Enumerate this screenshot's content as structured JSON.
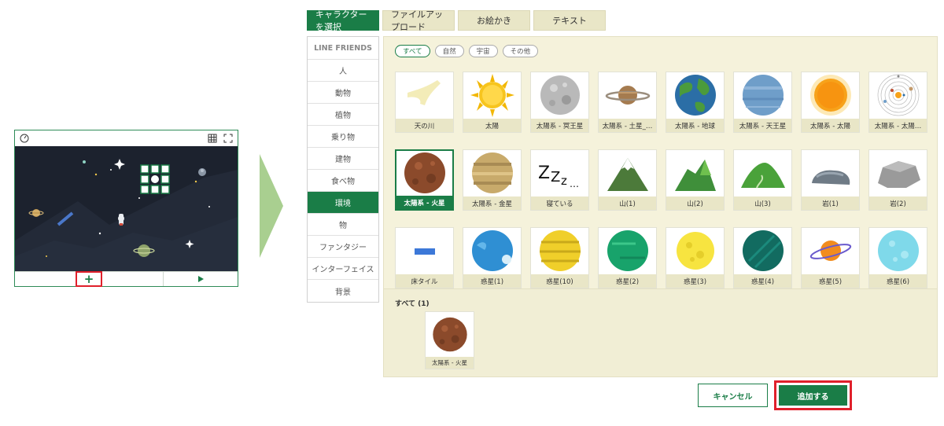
{
  "stage": {
    "add_label": "+",
    "play_label": "▶"
  },
  "tabs": [
    {
      "label": "キャラクターを選択",
      "active": true
    },
    {
      "label": "ファイルアップロード",
      "active": false
    },
    {
      "label": "お絵かき",
      "active": false
    },
    {
      "label": "テキスト",
      "active": false
    }
  ],
  "sidebar": {
    "items": [
      {
        "label": "LINE FRIENDS",
        "active": false
      },
      {
        "label": "人",
        "active": false
      },
      {
        "label": "動物",
        "active": false
      },
      {
        "label": "植物",
        "active": false
      },
      {
        "label": "乗り物",
        "active": false
      },
      {
        "label": "建物",
        "active": false
      },
      {
        "label": "食べ物",
        "active": false
      },
      {
        "label": "環境",
        "active": true
      },
      {
        "label": "物",
        "active": false
      },
      {
        "label": "ファンタジー",
        "active": false
      },
      {
        "label": "インターフェイス",
        "active": false
      },
      {
        "label": "背景",
        "active": false
      }
    ]
  },
  "filters": [
    {
      "label": "すべて",
      "active": true
    },
    {
      "label": "自然",
      "active": false
    },
    {
      "label": "宇宙",
      "active": false
    },
    {
      "label": "その他",
      "active": false
    }
  ],
  "characters": [
    {
      "label": "天の川",
      "icon": "milky-way-icon"
    },
    {
      "label": "太陽",
      "icon": "sun-icon"
    },
    {
      "label": "太陽系 - 冥王星",
      "icon": "pluto-icon"
    },
    {
      "label": "太陽系 - 土星_…",
      "icon": "saturn-icon"
    },
    {
      "label": "太陽系 - 地球",
      "icon": "earth-icon"
    },
    {
      "label": "太陽系 - 天王星",
      "icon": "uranus-icon"
    },
    {
      "label": "太陽系 - 太陽",
      "icon": "solar-sun-icon"
    },
    {
      "label": "太陽系 - 太陽…",
      "icon": "solar-system-icon"
    },
    {
      "label": "太陽系 - 火星",
      "icon": "mars-icon",
      "selected": true
    },
    {
      "label": "太陽系 - 金星",
      "icon": "venus-icon"
    },
    {
      "label": "寝ている",
      "icon": "sleeping-zzz-icon"
    },
    {
      "label": "山(1)",
      "icon": "mountain-1-icon"
    },
    {
      "label": "山(2)",
      "icon": "mountain-2-icon"
    },
    {
      "label": "山(3)",
      "icon": "mountain-3-icon"
    },
    {
      "label": "岩(1)",
      "icon": "rock-1-icon"
    },
    {
      "label": "岩(2)",
      "icon": "rock-2-icon"
    },
    {
      "label": "床タイル",
      "icon": "floor-tile-icon"
    },
    {
      "label": "惑星(1)",
      "icon": "planet-1-icon"
    },
    {
      "label": "惑星(10)",
      "icon": "planet-10-icon"
    },
    {
      "label": "惑星(2)",
      "icon": "planet-2-icon"
    },
    {
      "label": "惑星(3)",
      "icon": "planet-3-icon"
    },
    {
      "label": "惑星(4)",
      "icon": "planet-4-icon"
    },
    {
      "label": "惑星(5)",
      "icon": "planet-5-icon"
    },
    {
      "label": "惑星(6)",
      "icon": "planet-6-icon"
    }
  ],
  "selection": {
    "title": "すべて (1)",
    "items": [
      {
        "label": "太陽系 - 火星",
        "icon": "mars-icon"
      }
    ]
  },
  "buttons": {
    "cancel": "キャンセル",
    "add": "追加する"
  },
  "colors": {
    "accent": "#1a7d47",
    "highlight": "#e0202b",
    "panel_bg": "#f5f2db",
    "label_bg": "#e9e6c7"
  }
}
